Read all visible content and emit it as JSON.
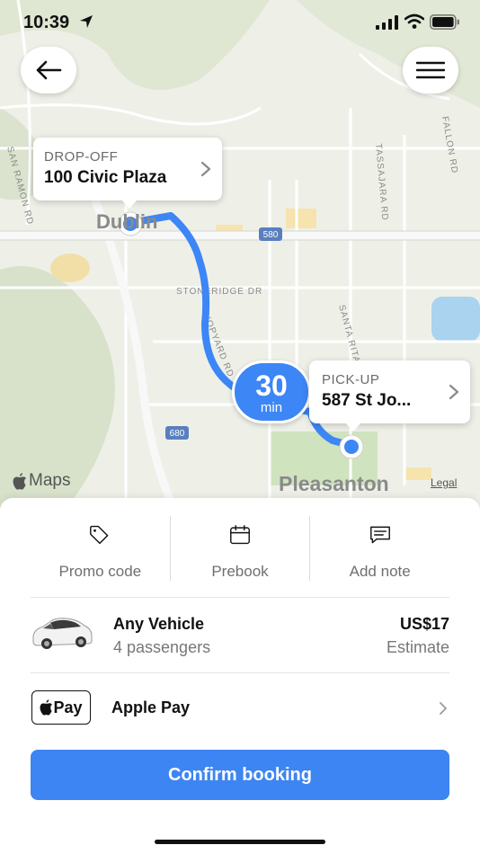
{
  "status": {
    "time": "10:39"
  },
  "map": {
    "dropoff": {
      "label": "DROP-OFF",
      "address": "100 Civic Plaza"
    },
    "pickup": {
      "label": "PICK-UP",
      "address": "587 St Jo..."
    },
    "eta": {
      "value": "30",
      "unit": "min"
    },
    "attribution": "Maps",
    "legal": "Legal",
    "cities": {
      "dublin": "Dublin",
      "pleasanton": "Pleasanton"
    },
    "roads": {
      "stoneridge": "STONERIDGE DR",
      "hopyard": "HOPYARD RD",
      "santarita": "SANTA RITA",
      "tassajara": "TASSAJARA RD",
      "fallon": "FALLON RD",
      "sanramon": "SAN RAMON RD",
      "i580": "580",
      "i680": "680"
    },
    "route_color": "#3c86f6"
  },
  "options": [
    {
      "icon": "tag-icon",
      "label": "Promo code"
    },
    {
      "icon": "calendar-icon",
      "label": "Prebook"
    },
    {
      "icon": "message-icon",
      "label": "Add note"
    }
  ],
  "vehicle": {
    "name": "Any Vehicle",
    "capacity": "4 passengers",
    "price": "US$17",
    "price_note": "Estimate"
  },
  "payment": {
    "badge_text": "Pay",
    "method": "Apple Pay"
  },
  "confirm_label": "Confirm booking",
  "accent_color": "#3d85f2"
}
